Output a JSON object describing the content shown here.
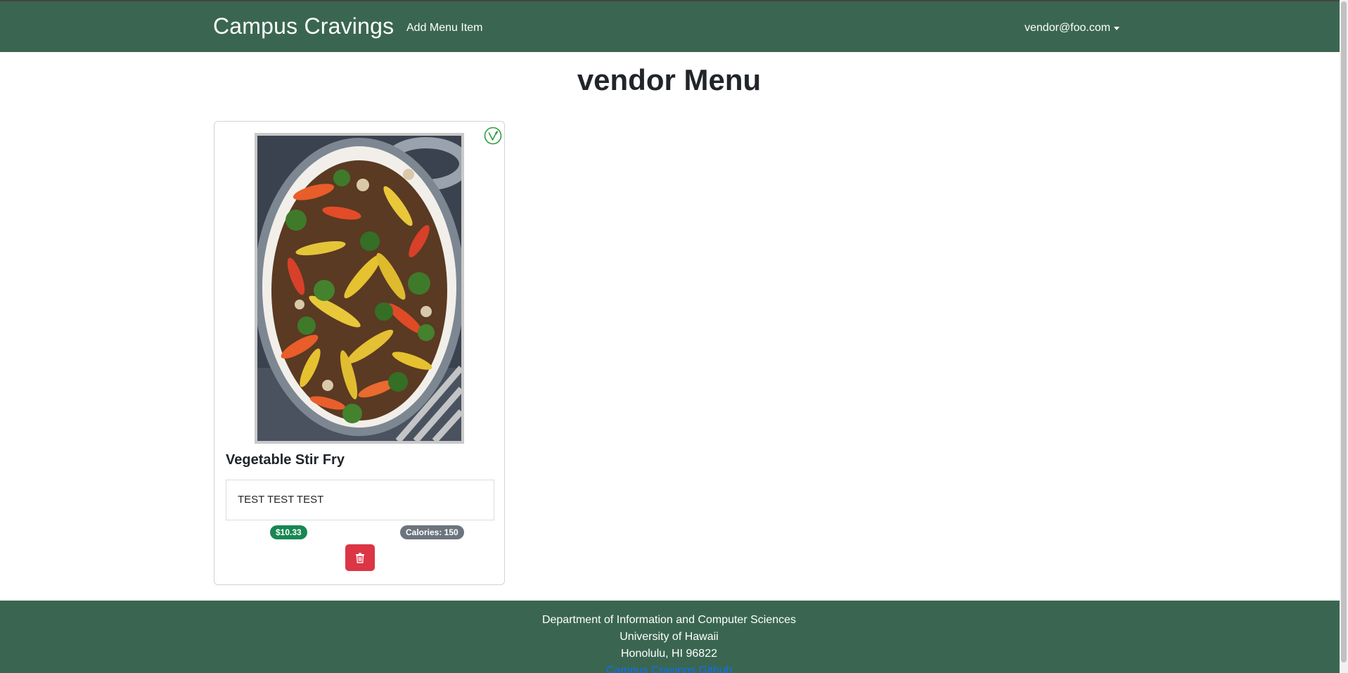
{
  "navbar": {
    "brand": "Campus Cravings",
    "add_menu_item_label": "Add Menu Item",
    "user_email": "vendor@foo.com"
  },
  "page": {
    "title": "vendor Menu"
  },
  "menu_items": [
    {
      "name": "Vegetable Stir Fry",
      "description": "TEST TEST TEST",
      "price": "$10.33",
      "calories": "Calories: 150",
      "vegan_icon": "vegan-leaf-icon",
      "delete_icon": "trash-icon"
    }
  ],
  "footer": {
    "line1": "Department of Information and Computer Sciences",
    "line2": "University of Hawaii",
    "line3": "Honolulu, HI 96822",
    "github_link": "Campus Cravings Github"
  },
  "colors": {
    "navbar": "#3a6651",
    "price_badge": "#198754",
    "calories_badge": "#6c757d",
    "delete_button": "#dc3545",
    "link": "#0d6efd"
  }
}
